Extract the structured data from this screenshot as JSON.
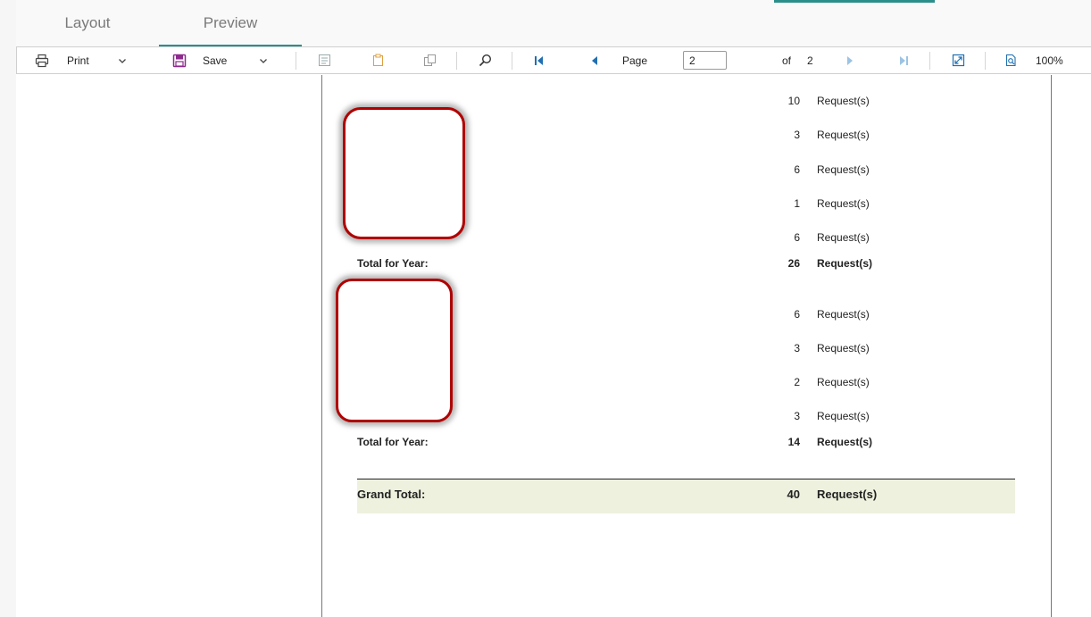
{
  "tabs": {
    "layout": "Layout",
    "preview": "Preview"
  },
  "toolbar": {
    "print_label": "Print",
    "save_label": "Save",
    "page_label": "Page",
    "page_value": "2",
    "of_label": "of",
    "total_pages": "2",
    "zoom": "100%"
  },
  "report": {
    "group1": {
      "rows": [
        {
          "count": "10",
          "unit": "Request(s)"
        },
        {
          "count": "3",
          "unit": "Request(s)"
        },
        {
          "count": "6",
          "unit": "Request(s)"
        },
        {
          "count": "1",
          "unit": "Request(s)"
        },
        {
          "count": "6",
          "unit": "Request(s)"
        }
      ],
      "total_label": "Total for Year:",
      "total_count": "26",
      "total_unit": "Request(s)"
    },
    "group2": {
      "rows": [
        {
          "count": "6",
          "unit": "Request(s)"
        },
        {
          "count": "3",
          "unit": "Request(s)"
        },
        {
          "count": "2",
          "unit": "Request(s)"
        },
        {
          "count": "3",
          "unit": "Request(s)"
        }
      ],
      "total_label": "Total for Year:",
      "total_count": "14",
      "total_unit": "Request(s)"
    },
    "grand_total": {
      "label": "Grand Total:",
      "count": "40",
      "unit": "Request(s)"
    }
  },
  "colors": {
    "accent": "#2a8f8a",
    "redaction_border": "#b00000",
    "grand_total_bg": "#edf1de",
    "save_icon": "#8e2a8e",
    "nav_icon": "#1f6fb2"
  }
}
